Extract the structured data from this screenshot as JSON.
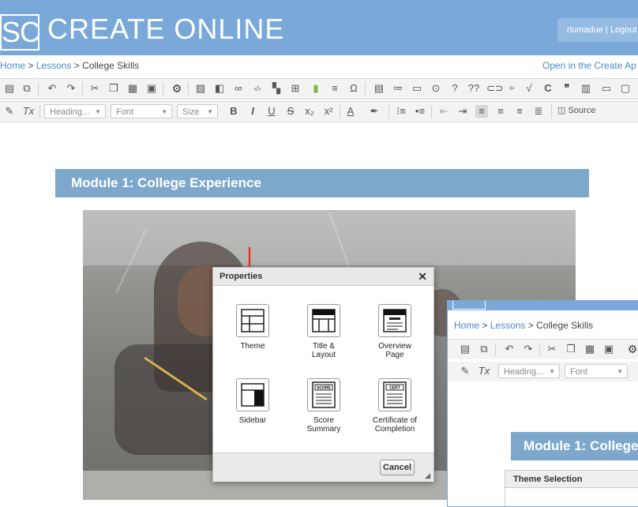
{
  "app": {
    "logo_text": "SC",
    "brand": "CREATE ONLINE",
    "user": "rlumadue",
    "separator": "|",
    "logout": "Logout"
  },
  "breadcrumb": {
    "home": "Home",
    "sep1": ">",
    "lessons": "Lessons",
    "sep2": ">",
    "current": "College Skills",
    "open_link": "Open in the Create Ap"
  },
  "toolbar": {
    "heading_combo": "Heading...",
    "font_combo": "Font",
    "size_combo": "Size",
    "source_label": "Source"
  },
  "module": {
    "title": "Module 1: College Experience"
  },
  "dialog": {
    "title": "Properties",
    "close": "✕",
    "options": [
      {
        "label": "Theme",
        "label2": ""
      },
      {
        "label": "Title &",
        "label2": "Layout"
      },
      {
        "label": "Overview",
        "label2": "Page"
      },
      {
        "label": "Sidebar",
        "label2": ""
      },
      {
        "label": "Score",
        "label2": "Summary"
      },
      {
        "label": "Certificate of",
        "label2": "Completion"
      }
    ],
    "score_text": "SCORE",
    "cert_text": "CERT",
    "cancel": "Cancel"
  },
  "overlay": {
    "home": "Home",
    "lessons": "Lessons",
    "current": "College Skills",
    "heading_combo": "Heading...",
    "font_combo": "Font",
    "module_title": "Module 1: College",
    "table_header": "Theme Selection"
  },
  "colors": {
    "header_blue": "#79a8d9",
    "module_bar": "#7da8cc",
    "link": "#4a89c8",
    "arrow": "#e53322"
  },
  "icons": [
    "save-icon",
    "preview-icon",
    "undo-icon",
    "redo-icon",
    "cut-icon",
    "copy-icon",
    "paste-icon",
    "paste-text-icon",
    "gear-icon",
    "image-icon",
    "flash-icon",
    "link-icon",
    "code-icon",
    "table-icon",
    "book-icon",
    "align-icon",
    "omega-icon",
    "source-icon",
    "list-icon",
    "form-icon",
    "play-icon",
    "question-icon",
    "quote-icon",
    "bold-icon",
    "italic-icon",
    "underline-icon",
    "strike-icon"
  ]
}
